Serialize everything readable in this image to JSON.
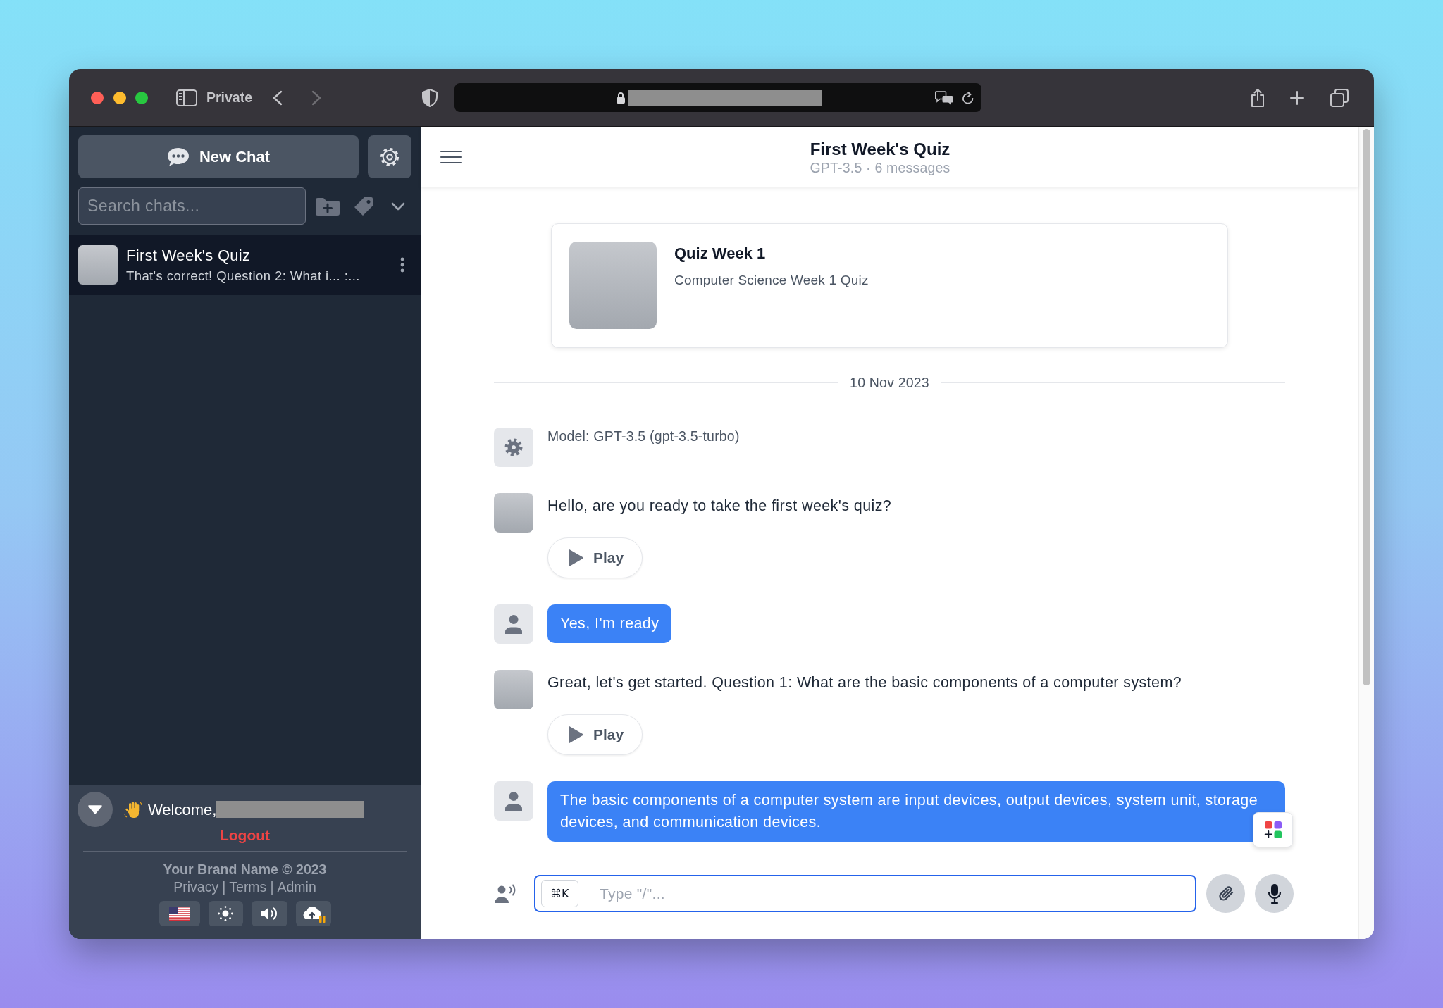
{
  "browser": {
    "private_label": "Private"
  },
  "sidebar": {
    "new_chat": "New Chat",
    "search": {
      "placeholder": "Search chats..."
    },
    "chats": [
      {
        "title": "First Week's Quiz",
        "preview": "That's correct! Question 2: What i... :...",
        "selected": true
      }
    ],
    "footer": {
      "welcome": "Welcome,",
      "logout": "Logout",
      "brand": "Your Brand Name © 2023",
      "links": [
        "Privacy",
        "Terms",
        "Admin"
      ],
      "link_separator": "|"
    }
  },
  "chat": {
    "title": "First Week's Quiz",
    "subtitle": "GPT-3.5 · 6 messages",
    "bot_card": {
      "name": "Quiz Week 1",
      "description": "Computer Science Week 1 Quiz"
    },
    "date": "10 Nov 2023",
    "messages": [
      {
        "kind": "system",
        "text": "Model: GPT-3.5 (gpt-3.5-turbo)"
      },
      {
        "kind": "assistant",
        "text": "Hello, are you ready to take the first week's quiz?",
        "play_label": "Play"
      },
      {
        "kind": "user",
        "text": "Yes, I'm ready"
      },
      {
        "kind": "assistant",
        "text": "Great, let's get started. Question 1: What are the basic components of a computer system?",
        "play_label": "Play"
      },
      {
        "kind": "user",
        "text": "The basic components of a computer system are input devices, output devices, system unit, storage devices, and communication devices."
      }
    ],
    "input": {
      "shortcut": "⌘K",
      "placeholder": "Type \"/\"..."
    }
  }
}
